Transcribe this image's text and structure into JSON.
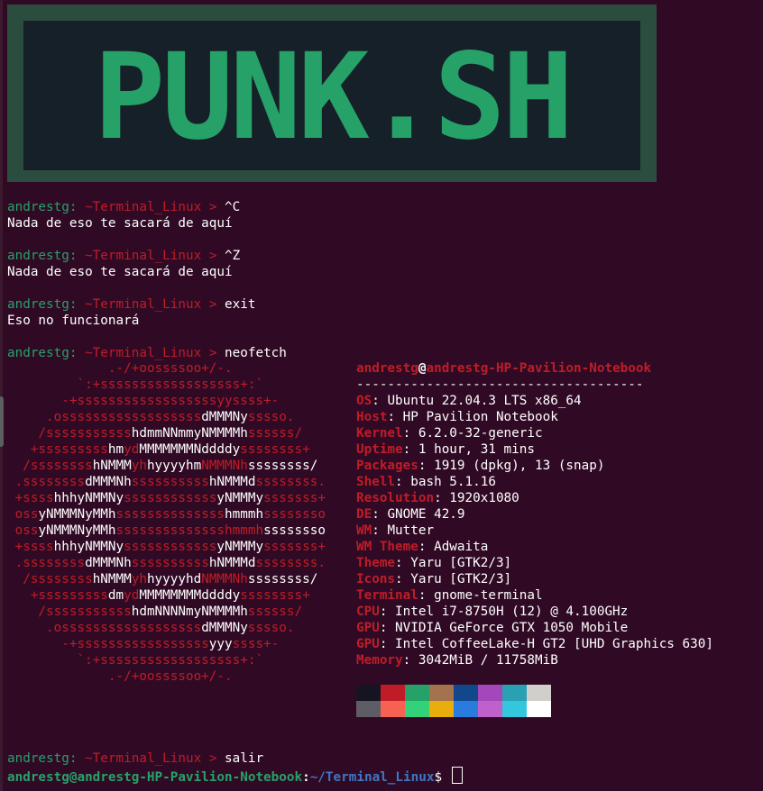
{
  "banner": {
    "text": "PUNK.SH"
  },
  "history": [
    {
      "user": "andrestg:",
      "path": "~Terminal_Linux",
      "arrow": ">",
      "cmd": "^C",
      "out": "Nada de eso te sacará de aquí"
    },
    {
      "user": "andrestg:",
      "path": "~Terminal_Linux",
      "arrow": ">",
      "cmd": "^Z",
      "out": "Nada de eso te sacará de aquí"
    },
    {
      "user": "andrestg:",
      "path": "~Terminal_Linux",
      "arrow": ">",
      "cmd": "exit",
      "out": "Eso no funcionará"
    },
    {
      "user": "andrestg:",
      "path": "~Terminal_Linux",
      "arrow": ">",
      "cmd": "neofetch",
      "out": ""
    }
  ],
  "neofetch": {
    "logo_lines": [
      [
        "             .-/+oossssoo+/-.",
        ""
      ],
      [
        "         `:+ssssssssssssssssss+:`",
        ""
      ],
      [
        "       -+ssssssssssssssssssyyssss+-",
        ""
      ],
      [
        "     .ossssssssssssssssss",
        "dMMMNy",
        "sssso."
      ],
      [
        "    /sssssssssss",
        "hdmmNNmmyNMMMMh",
        "ssssss/"
      ],
      [
        "   +sssssssss",
        "hm",
        "yd",
        "MMMMMMMNddddy",
        "ssssssss+"
      ],
      [
        "  /ssssssss",
        "hNMMM",
        "yh",
        "hyyyyhm",
        "NMMMNh",
        "ssssssss/"
      ],
      [
        " .ssssssss",
        "dMMMNh",
        "ssssssssss",
        "hNMMMd",
        "ssssssss."
      ],
      [
        " +ssss",
        "hhhyNMMNy",
        "ssssssssssss",
        "yNMMMy",
        "sssssss+"
      ],
      [
        " oss",
        "yNMMMNyMMh",
        "ssssssssssssss",
        "hmmmh",
        "ssssssso"
      ],
      [
        " oss",
        "yNMMMNyMMh",
        "sssssssssssssshmmmh",
        "ssssssso"
      ],
      [
        " +ssss",
        "hhhyNMMNy",
        "ssssssssssss",
        "yNMMMy",
        "sssssss+"
      ],
      [
        " .ssssssss",
        "dMMMNh",
        "ssssssssss",
        "hNMMMd",
        "ssssssss."
      ],
      [
        "  /ssssssss",
        "hNMMM",
        "yh",
        "hyyyyhd",
        "NMMMNh",
        "ssssssss/"
      ],
      [
        "   +sssssssss",
        "dm",
        "yd",
        "MMMMMMMMddddy",
        "ssssssss+"
      ],
      [
        "    /sssssssssss",
        "hdmNNNNmyNMMMMh",
        "ssssss/"
      ],
      [
        "     .ossssssssssssssssss",
        "dMMMNy",
        "sssso."
      ],
      [
        "       -+sssssssssssssssss",
        "yyy",
        "ssss+-"
      ],
      [
        "         `:+ssssssssssssssssss+:`",
        ""
      ],
      [
        "             .-/+oossssoo+/-.",
        ""
      ]
    ],
    "header": {
      "user": "andrestg",
      "at": "@",
      "host": "andrestg-HP-Pavilion-Notebook"
    },
    "separator": "-------------------------------------",
    "fields": [
      {
        "key": "OS",
        "value": "Ubuntu 22.04.3 LTS x86_64"
      },
      {
        "key": "Host",
        "value": "HP Pavilion Notebook"
      },
      {
        "key": "Kernel",
        "value": "6.2.0-32-generic"
      },
      {
        "key": "Uptime",
        "value": "1 hour, 31 mins"
      },
      {
        "key": "Packages",
        "value": "1919 (dpkg), 13 (snap)"
      },
      {
        "key": "Shell",
        "value": "bash 5.1.16"
      },
      {
        "key": "Resolution",
        "value": "1920x1080"
      },
      {
        "key": "DE",
        "value": "GNOME 42.9"
      },
      {
        "key": "WM",
        "value": "Mutter"
      },
      {
        "key": "WM Theme",
        "value": "Adwaita"
      },
      {
        "key": "Theme",
        "value": "Yaru [GTK2/3]"
      },
      {
        "key": "Icons",
        "value": "Yaru [GTK2/3]"
      },
      {
        "key": "Terminal",
        "value": "gnome-terminal"
      },
      {
        "key": "CPU",
        "value": "Intel i7-8750H (12) @ 4.100GHz"
      },
      {
        "key": "GPU",
        "value": "NVIDIA GeForce GTX 1050 Mobile"
      },
      {
        "key": "GPU",
        "value": "Intel CoffeeLake-H GT2 [UHD Graphics 630]"
      },
      {
        "key": "Memory",
        "value": "3042MiB / 11758MiB"
      }
    ],
    "palette_top": [
      "#171421",
      "#c01c28",
      "#26a269",
      "#a2734c",
      "#12488b",
      "#a347ba",
      "#2aa1b3",
      "#d0cfcc"
    ],
    "palette_bottom": [
      "#5e5c64",
      "#f66151",
      "#33d17a",
      "#e9ad0c",
      "#2a7bde",
      "#c061cb",
      "#33c7de",
      "#ffffff"
    ]
  },
  "salir": {
    "user": "andrestg:",
    "path": "~Terminal_Linux",
    "arrow": ">",
    "cmd": "salir"
  },
  "prompt": {
    "userhost": "andrestg@andrestg-HP-Pavilion-Notebook",
    "colon": ":",
    "cwd": "~/Terminal_Linux",
    "dollar": "$"
  },
  "colors": {
    "background": "#300a24",
    "green": "#26a269",
    "red": "#c01c28",
    "blue": "#3e77c4"
  }
}
